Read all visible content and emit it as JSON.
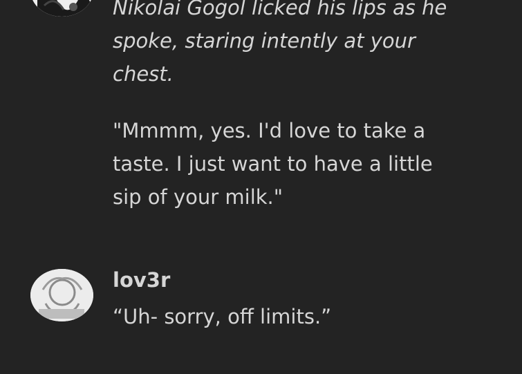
{
  "messages": [
    {
      "author": "",
      "narration": "Nikolai Gogol licked his lips as he spoke, staring intently at your chest.",
      "speech": "\"Mmmm, yes. I'd love to take a taste. I just want to have a little sip of your milk.\""
    },
    {
      "author": "lov3r",
      "text": "“Uh- sorry, off limits.”"
    }
  ],
  "icons": {
    "avatar_top": "user-avatar-icon",
    "avatar_bottom": "user-avatar-icon"
  }
}
